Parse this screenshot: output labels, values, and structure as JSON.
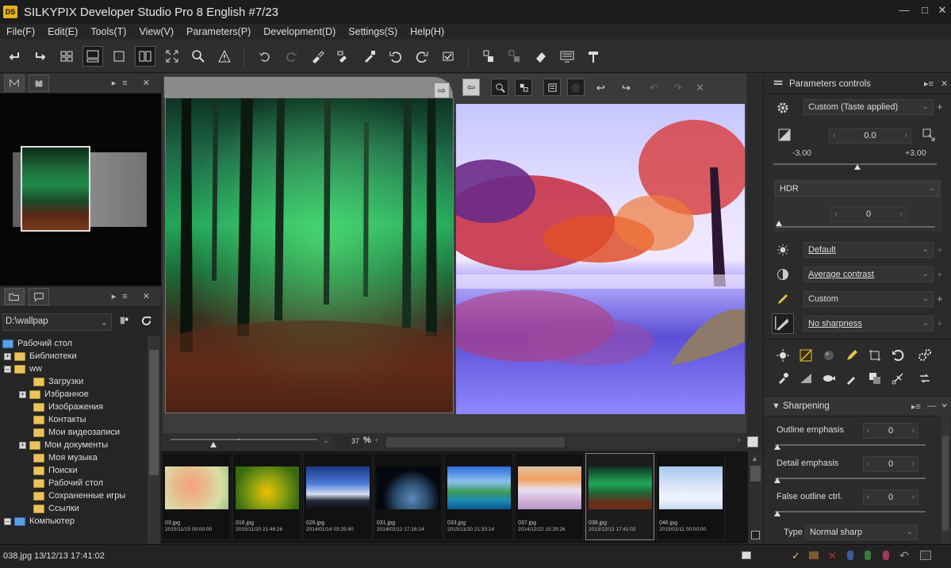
{
  "window": {
    "title": "SILKYPIX Developer Studio Pro 8 English   #7/23",
    "app_badge": "DS"
  },
  "menu": [
    "File(F)",
    "Edit(E)",
    "Tools(T)",
    "View(V)",
    "Parameters(P)",
    "Development(D)",
    "Settings(S)",
    "Help(H)"
  ],
  "left_panel": {
    "path": "D:\\wallpap",
    "tree": [
      {
        "label": "Рабочий стол"
      },
      {
        "label": "Библиотеки"
      },
      {
        "label": "ww"
      },
      {
        "label": "Загрузки"
      },
      {
        "label": "Избранное"
      },
      {
        "label": "Изображения"
      },
      {
        "label": "Контакты"
      },
      {
        "label": "Мои видеозаписи"
      },
      {
        "label": "Мои документы"
      },
      {
        "label": "Моя музыка"
      },
      {
        "label": "Поиски"
      },
      {
        "label": "Рабочий стол"
      },
      {
        "label": "Сохраненные игры"
      },
      {
        "label": "Ссылки"
      },
      {
        "label": "Компьютер"
      }
    ]
  },
  "viewer": {
    "zoom": "37",
    "zoom_unit": "%"
  },
  "filmstrip": [
    {
      "name": "03.jpg",
      "date": "2015/11/15 00:00:00"
    },
    {
      "name": "016.jpg",
      "date": "2015/11/20 21:46:26"
    },
    {
      "name": "026.jpg",
      "date": "2014/01/14 03:25:40"
    },
    {
      "name": "031.jpg",
      "date": "2014/02/12 17:16:14"
    },
    {
      "name": "033.jpg",
      "date": "2015/11/20 21:33:14"
    },
    {
      "name": "037.jpg",
      "date": "2014/12/22 15:29:26"
    },
    {
      "name": "038.jpg",
      "date": "2013/12/13 17:41:02"
    },
    {
      "name": "046.jpg",
      "date": "2015/02/11 00:00:00"
    }
  ],
  "params": {
    "header": "Parameters controls",
    "taste": "Custom (Taste applied)",
    "exposure_value": "0.0",
    "exposure_min": "-3.00",
    "exposure_max": "+3.00",
    "hdr_label": "HDR",
    "hdr_value": "0",
    "white_balance": "Default",
    "tone": "Average contrast",
    "color": "Custom",
    "sharpness": "No sharpness",
    "sharpening_header": "Sharpening",
    "outline_label": "Outline emphasis",
    "outline_value": "0",
    "detail_label": "Detail emphasis",
    "detail_value": "0",
    "false_label": "False outline ctrl.",
    "false_value": "0",
    "type_label": "Type",
    "type_value": "Normal sharp"
  },
  "status": {
    "text": "038.jpg 13/12/13 17:41:02"
  }
}
